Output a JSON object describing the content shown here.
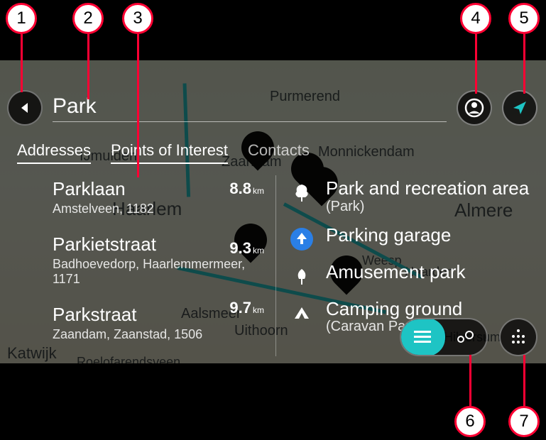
{
  "search": {
    "query": "Park"
  },
  "tabs": {
    "addresses": "Addresses",
    "poi": "Points of Interest",
    "contacts": "Contacts"
  },
  "addresses": [
    {
      "title": "Parklaan",
      "subtitle": "Amstelveen, 1182",
      "dist": "8.8",
      "unit": "km"
    },
    {
      "title": "Parkietstraat",
      "subtitle": "Badhoevedorp, Haarlemmermeer, 1171",
      "dist": "9.3",
      "unit": "km"
    },
    {
      "title": "Parkstraat",
      "subtitle": "Zaandam, Zaanstad, 1506",
      "dist": "9.7",
      "unit": "km"
    }
  ],
  "poi_results": [
    {
      "title": "Park and recreation area",
      "subtitle": "(Park)"
    },
    {
      "title": "Parking garage",
      "subtitle": ""
    },
    {
      "title": "Amusement park",
      "subtitle": ""
    },
    {
      "title": "Camping ground",
      "subtitle": "(Caravan Park)"
    }
  ],
  "map_labels": [
    "Purmerend",
    "IJmuiden",
    "Zaandam",
    "Monnickendam",
    "Haarlem",
    "Almere",
    "Aalsmeer",
    "Katwijk",
    "Uithoorn",
    "Roelofarendsveen",
    "Naarden",
    "Weesp",
    "Hilversum"
  ],
  "callouts": {
    "c1": "1",
    "c2": "2",
    "c3": "3",
    "c4": "4",
    "c5": "5",
    "c6": "6",
    "c7": "7"
  }
}
